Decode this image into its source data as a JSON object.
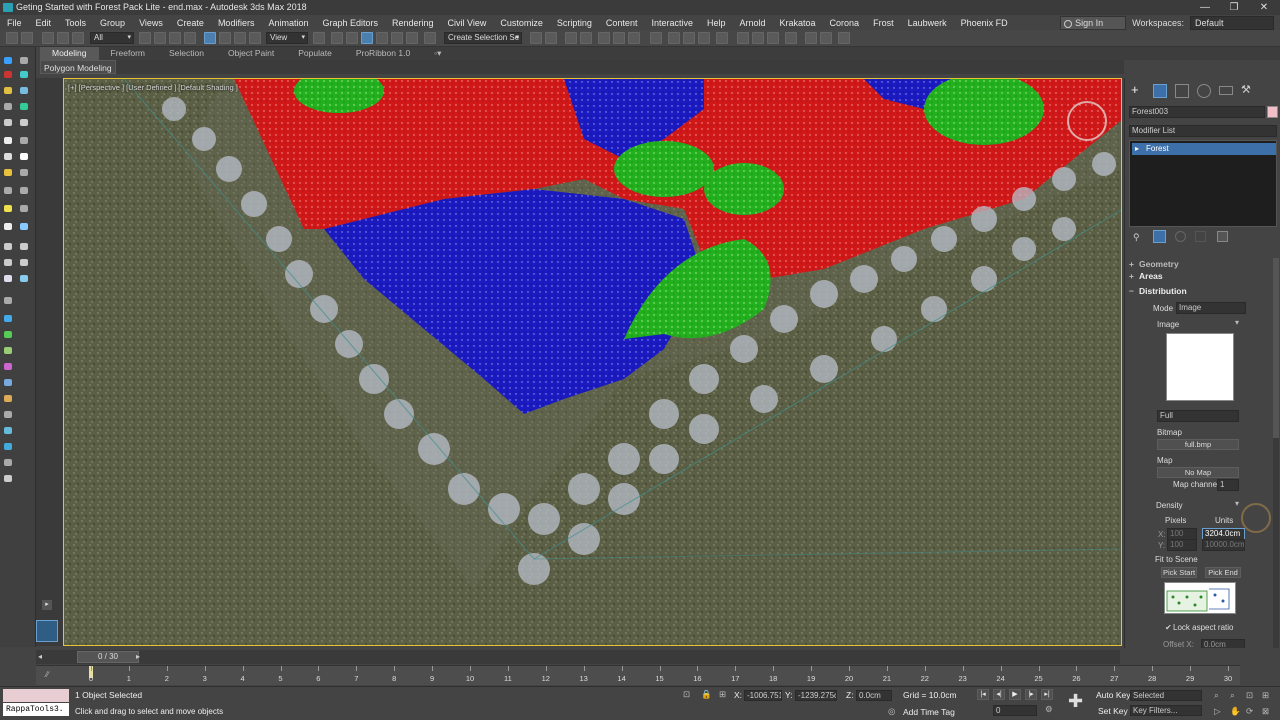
{
  "window": {
    "title": "Geting Started with Forest Pack Lite - end.max - Autodesk 3ds Max 2018",
    "controls": [
      "—",
      "❐",
      "✕"
    ]
  },
  "menu": {
    "items": [
      "File",
      "Edit",
      "Tools",
      "Group",
      "Views",
      "Create",
      "Modifiers",
      "Animation",
      "Graph Editors",
      "Rendering",
      "Civil View",
      "Customize",
      "Scripting",
      "Content",
      "Interactive",
      "Help",
      "Arnold",
      "Krakatoa",
      "Corona",
      "Frost",
      "Laubwerk",
      "Phoenix FD"
    ],
    "sign_in": "Sign In",
    "workspaces_label": "Workspaces:",
    "workspaces_value": "Default"
  },
  "toolbar": {
    "filter_value": "All",
    "refcoord_value": "View",
    "selection_set_value": "Create Selection Se"
  },
  "ribbon": {
    "tabs": [
      "Modeling",
      "Freeform",
      "Selection",
      "Object Paint",
      "Populate",
      "ProRibbon 1.0"
    ],
    "active_tab": "Modeling",
    "panel_button": "Polygon Modeling"
  },
  "viewport": {
    "label": "[+] [Perspective ] [User Defined ] [Default Shading ]"
  },
  "command_panel": {
    "object_name": "Forest003",
    "modifier_list": "Modifier List",
    "stack_item": "Forest",
    "rollout_geometry": "Geometry",
    "rollout_areas": "Areas",
    "rollout_distribution": "Distribution",
    "mode_label": "Mode",
    "mode_value": "Image",
    "image_label": "Image",
    "image_preset_value": "Full",
    "bitmap_label": "Bitmap",
    "bitmap_value": "full.bmp",
    "map_label": "Map",
    "map_value": "No Map",
    "map_channel_label": "Map channel",
    "map_channel_value": "1",
    "density_label": "Density",
    "pixels_label": "Pixels",
    "units_label": "Units",
    "x_label": "X:",
    "x_pixels": "100",
    "x_units": "3204.0cm",
    "y_label": "Y:",
    "y_pixels": "100",
    "y_units": "10000.0cm",
    "fit_to_scene": "Fit to Scene",
    "pick_start": "Pick Start",
    "pick_end": "Pick End",
    "lock_aspect": "Lock aspect ratio",
    "offset_label": "Offset X:",
    "offset_value": "0.0cm"
  },
  "timeslider": {
    "label": "0 / 30",
    "ticks": [
      "0",
      "1",
      "2",
      "3",
      "4",
      "5",
      "6",
      "7",
      "8",
      "9",
      "10",
      "11",
      "12",
      "13",
      "14",
      "15",
      "16",
      "17",
      "18",
      "19",
      "20",
      "21",
      "22",
      "23",
      "24",
      "25",
      "26",
      "27",
      "28",
      "29",
      "30"
    ]
  },
  "status": {
    "maxscript": "RappaTools3.",
    "selection_count": "1 Object Selected",
    "prompt": "Click and drag to select and move objects",
    "x_label": "X:",
    "x_value": "-1006.751c",
    "y_label": "Y:",
    "y_value": "-1239.275c",
    "z_label": "Z:",
    "z_value": "0.0cm",
    "grid": "Grid = 10.0cm",
    "add_time_tag": "Add Time Tag",
    "frame_value": "0",
    "auto_key": "Auto Key",
    "set_key": "Set Key",
    "key_mode_value": "Selected",
    "key_filters": "Key Filters..."
  },
  "colors": {
    "accent": "#3d6fa8",
    "viewport_border": "#e7c233",
    "distribution_red": "#d01818",
    "distribution_blue": "#1a1ac0",
    "distribution_green": "#22b01e"
  }
}
